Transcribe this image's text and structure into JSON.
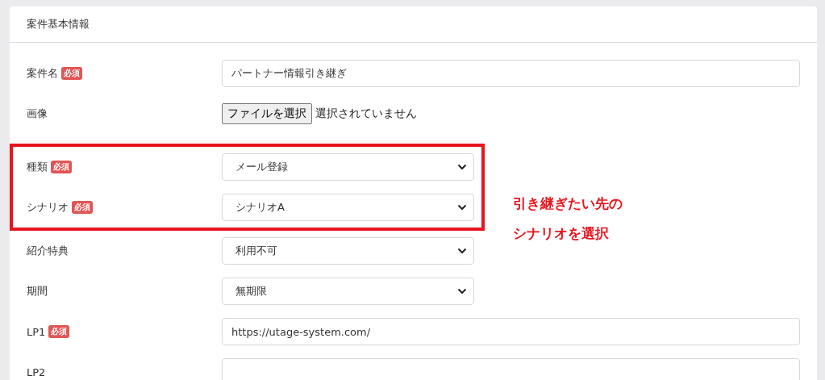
{
  "card": {
    "title": "案件基本情報"
  },
  "sections": [
    {
      "kind": "plain",
      "fields": [
        {
          "kind": "text",
          "label": "案件名",
          "badge": "必須",
          "value": "パートナー情報引き継ぎ"
        },
        {
          "kind": "file",
          "label": "画像",
          "button": "ファイルを選択",
          "status": "選択されていません"
        }
      ]
    },
    {
      "kind": "highlighted",
      "fields": [
        {
          "kind": "select",
          "label": "種類",
          "badge": "必須",
          "value": "メール登録"
        },
        {
          "kind": "select",
          "label": "シナリオ",
          "badge": "必須",
          "value": "シナリオA"
        }
      ]
    },
    {
      "kind": "plain",
      "fields": [
        {
          "kind": "select",
          "label": "紹介特典",
          "value": "利用不可"
        },
        {
          "kind": "select",
          "label": "期間",
          "value": "無期限"
        },
        {
          "kind": "text",
          "label": "LP1",
          "badge": "必須",
          "value": "https://utage-system.com/"
        },
        {
          "kind": "text",
          "label": "LP2"
        }
      ]
    }
  ],
  "callout": {
    "lines": [
      "引き継ぎたい先の",
      "シナリオを選択"
    ]
  }
}
